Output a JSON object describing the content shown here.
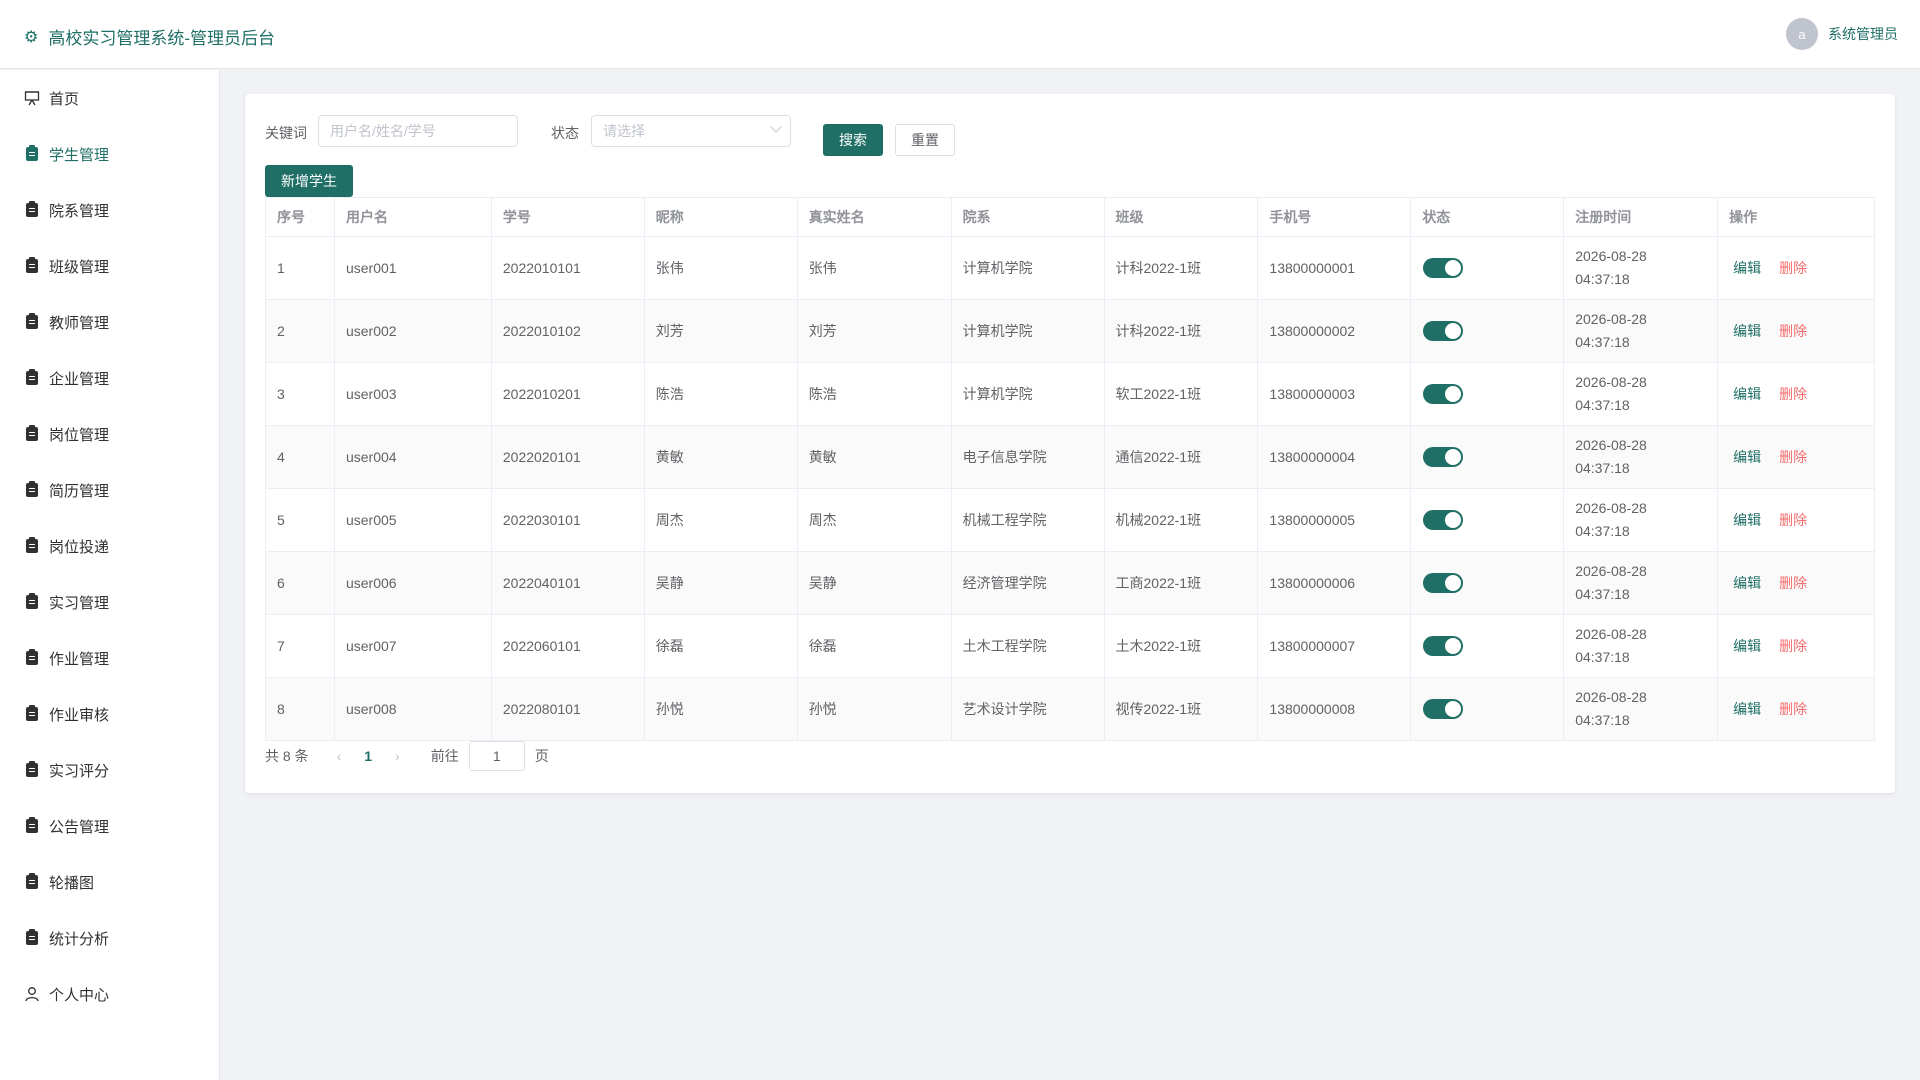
{
  "app": {
    "title": "高校实习管理系统-管理员后台"
  },
  "user": {
    "avatar_letter": "a",
    "name": "系统管理员"
  },
  "sidebar": {
    "items": [
      {
        "label": "首页",
        "icon": "presentation-icon"
      },
      {
        "label": "学生管理",
        "icon": "clipboard-icon",
        "active": true
      },
      {
        "label": "院系管理",
        "icon": "clipboard-icon"
      },
      {
        "label": "班级管理",
        "icon": "clipboard-icon"
      },
      {
        "label": "教师管理",
        "icon": "clipboard-icon"
      },
      {
        "label": "企业管理",
        "icon": "clipboard-icon"
      },
      {
        "label": "岗位管理",
        "icon": "clipboard-icon"
      },
      {
        "label": "简历管理",
        "icon": "clipboard-icon"
      },
      {
        "label": "岗位投递",
        "icon": "clipboard-icon"
      },
      {
        "label": "实习管理",
        "icon": "clipboard-icon"
      },
      {
        "label": "作业管理",
        "icon": "clipboard-icon"
      },
      {
        "label": "作业审核",
        "icon": "clipboard-icon"
      },
      {
        "label": "实习评分",
        "icon": "clipboard-icon"
      },
      {
        "label": "公告管理",
        "icon": "clipboard-icon"
      },
      {
        "label": "轮播图",
        "icon": "clipboard-icon"
      },
      {
        "label": "统计分析",
        "icon": "clipboard-icon"
      },
      {
        "label": "个人中心",
        "icon": "user-icon"
      }
    ]
  },
  "filter": {
    "keyword_label": "关键词",
    "keyword_placeholder": "用户名/姓名/学号",
    "status_label": "状态",
    "status_placeholder": "请选择",
    "search_label": "搜索",
    "reset_label": "重置"
  },
  "actions": {
    "add_label": "新增学生"
  },
  "table": {
    "columns": [
      "序号",
      "用户名",
      "学号",
      "昵称",
      "真实姓名",
      "院系",
      "班级",
      "手机号",
      "状态",
      "注册时间",
      "操作"
    ],
    "edit_label": "编辑",
    "delete_label": "删除",
    "rows": [
      {
        "index": "1",
        "username": "user001",
        "student_no": "2022010101",
        "nickname": "张伟",
        "real_name": "张伟",
        "department": "计算机学院",
        "class_name": "计科2022-1班",
        "phone": "13800000001",
        "enabled": true,
        "reg_date": "2026-08-28",
        "reg_time": "04:37:18"
      },
      {
        "index": "2",
        "username": "user002",
        "student_no": "2022010102",
        "nickname": "刘芳",
        "real_name": "刘芳",
        "department": "计算机学院",
        "class_name": "计科2022-1班",
        "phone": "13800000002",
        "enabled": true,
        "reg_date": "2026-08-28",
        "reg_time": "04:37:18"
      },
      {
        "index": "3",
        "username": "user003",
        "student_no": "2022010201",
        "nickname": "陈浩",
        "real_name": "陈浩",
        "department": "计算机学院",
        "class_name": "软工2022-1班",
        "phone": "13800000003",
        "enabled": true,
        "reg_date": "2026-08-28",
        "reg_time": "04:37:18"
      },
      {
        "index": "4",
        "username": "user004",
        "student_no": "2022020101",
        "nickname": "黄敏",
        "real_name": "黄敏",
        "department": "电子信息学院",
        "class_name": "通信2022-1班",
        "phone": "13800000004",
        "enabled": true,
        "reg_date": "2026-08-28",
        "reg_time": "04:37:18"
      },
      {
        "index": "5",
        "username": "user005",
        "student_no": "2022030101",
        "nickname": "周杰",
        "real_name": "周杰",
        "department": "机械工程学院",
        "class_name": "机械2022-1班",
        "phone": "13800000005",
        "enabled": true,
        "reg_date": "2026-08-28",
        "reg_time": "04:37:18"
      },
      {
        "index": "6",
        "username": "user006",
        "student_no": "2022040101",
        "nickname": "吴静",
        "real_name": "吴静",
        "department": "经济管理学院",
        "class_name": "工商2022-1班",
        "phone": "13800000006",
        "enabled": true,
        "reg_date": "2026-08-28",
        "reg_time": "04:37:18"
      },
      {
        "index": "7",
        "username": "user007",
        "student_no": "2022060101",
        "nickname": "徐磊",
        "real_name": "徐磊",
        "department": "土木工程学院",
        "class_name": "土木2022-1班",
        "phone": "13800000007",
        "enabled": true,
        "reg_date": "2026-08-28",
        "reg_time": "04:37:18"
      },
      {
        "index": "8",
        "username": "user008",
        "student_no": "2022080101",
        "nickname": "孙悦",
        "real_name": "孙悦",
        "department": "艺术设计学院",
        "class_name": "视传2022-1班",
        "phone": "13800000008",
        "enabled": true,
        "reg_date": "2026-08-28",
        "reg_time": "04:37:18"
      }
    ]
  },
  "pagination": {
    "total_text": "共 8 条",
    "current_page": "1",
    "goto_prefix": "前往",
    "goto_value": "1",
    "goto_suffix": "页"
  },
  "colors": {
    "primary": "#1f6f66",
    "danger": "#f56c6c",
    "background": "#f0f2f5"
  }
}
